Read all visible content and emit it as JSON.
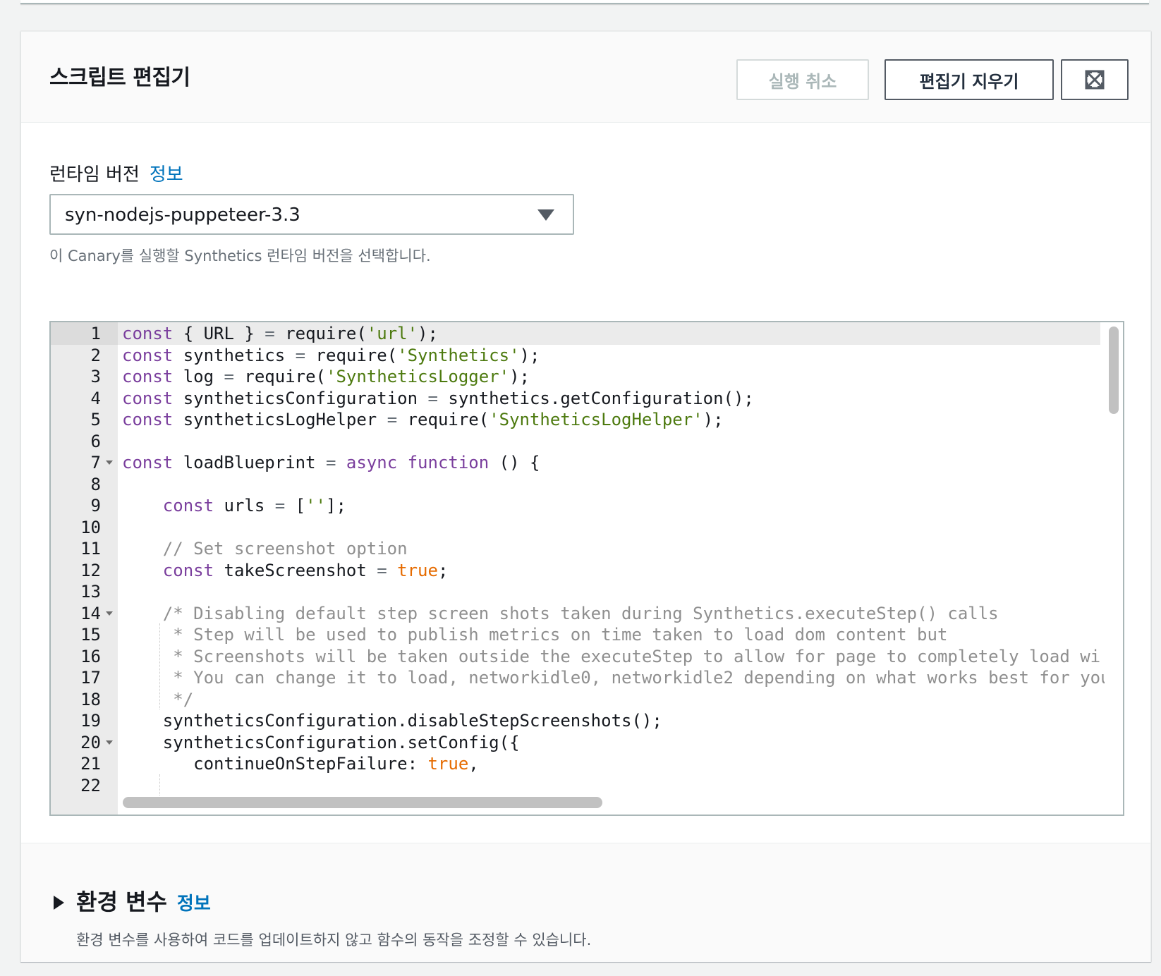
{
  "card": {
    "title": "스크립트 편집기",
    "buttons": {
      "cancel": "실행 취소",
      "clear": "편집기 지우기",
      "expand_icon": "expand-icon"
    }
  },
  "runtime": {
    "label": "런타임 버전",
    "info": "정보",
    "selected": "syn-nodejs-puppeteer-3.3",
    "description": "이 Canary를 실행할 Synthetics 런타임 버전을 선택합니다."
  },
  "editor": {
    "line_numbers": [
      "1",
      "2",
      "3",
      "4",
      "5",
      "6",
      "7",
      "8",
      "9",
      "10",
      "11",
      "12",
      "13",
      "14",
      "15",
      "16",
      "17",
      "18",
      "19",
      "20",
      "21",
      "22"
    ],
    "lines": [
      "const { URL } = require('url');",
      "const synthetics = require('Synthetics');",
      "const log = require('SyntheticsLogger');",
      "const syntheticsConfiguration = synthetics.getConfiguration();",
      "const syntheticsLogHelper = require('SyntheticsLogHelper');",
      "",
      "const loadBlueprint = async function () {",
      "",
      "    const urls = [''];",
      "",
      "    // Set screenshot option",
      "    const takeScreenshot = true;",
      "",
      "    /* Disabling default step screen shots taken during Synthetics.executeStep() calls",
      "     * Step will be used to publish metrics on time taken to load dom content but",
      "     * Screenshots will be taken outside the executeStep to allow for page to completely load wi",
      "     * You can change it to load, networkidle0, networkidle2 depending on what works best for you",
      "     */",
      "    syntheticsConfiguration.disableStepScreenshots();",
      "    syntheticsConfiguration.setConfig({",
      "       continueOnStepFailure: true,",
      ""
    ],
    "fold_lines": [
      7,
      14,
      20
    ],
    "active_line": 1
  },
  "env": {
    "title": "환경 변수",
    "info": "정보",
    "description": "환경 변수를 사용하여 코드를 업데이트하지 않고 함수의 동작을 조정할 수 있습니다."
  },
  "colors": {
    "link": "#0073bb",
    "keyword": "#7a3e9d",
    "string": "#4d7a0f",
    "boolean": "#e66b00",
    "comment": "#8f8f8f"
  }
}
